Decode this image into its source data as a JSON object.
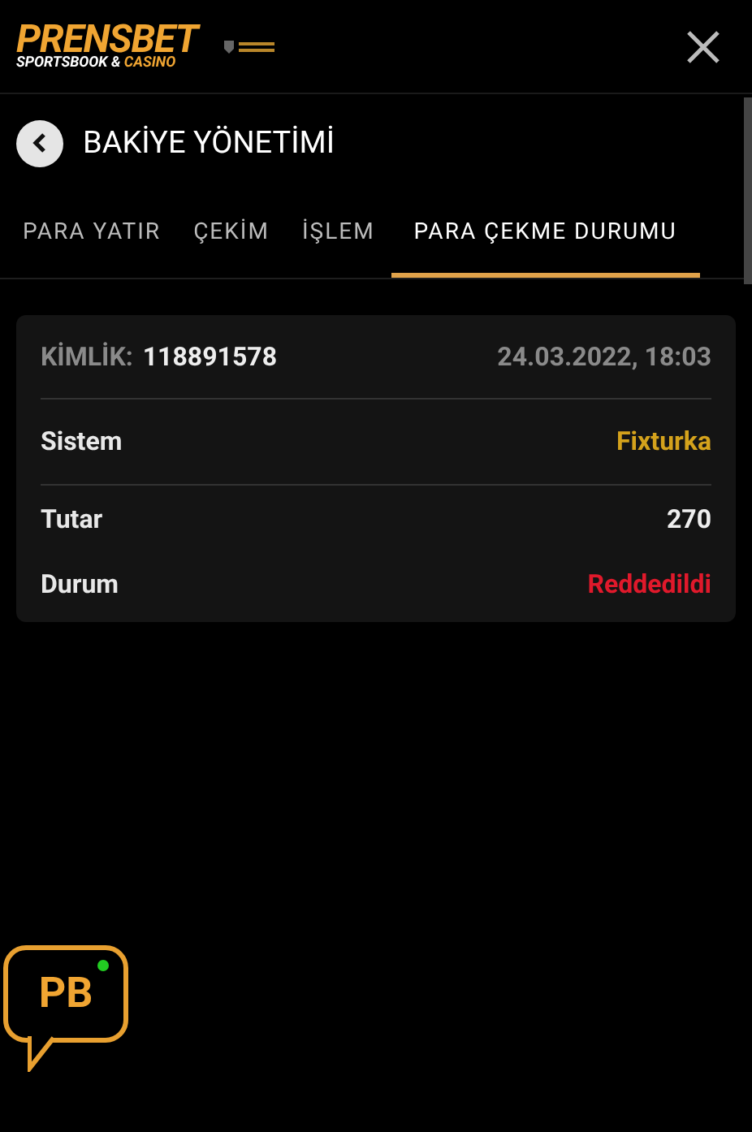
{
  "header": {
    "logo_main": "PRENSBET",
    "logo_sub_1": "SPORTSBOOK &",
    "logo_sub_2": "CASINO"
  },
  "page_title": "BAKİYE YÖNETİMİ",
  "tabs": [
    {
      "label": "PARA YATIR",
      "selected": false
    },
    {
      "label": "ÇEKİM",
      "selected": false
    },
    {
      "label": "İŞLEM",
      "selected": false
    },
    {
      "label": "PARA ÇEKME DURUMU",
      "selected": true
    }
  ],
  "record": {
    "id_label": "KİMLİK:",
    "id_value": "118891578",
    "date": "24.03.2022, 18:03",
    "rows": [
      {
        "label": "Sistem",
        "value": "Fixturka",
        "kind": "system",
        "divider": true
      },
      {
        "label": "Tutar",
        "value": "270",
        "kind": "plain",
        "divider": false
      },
      {
        "label": "Durum",
        "value": "Reddedildi",
        "kind": "status",
        "divider": false
      }
    ]
  },
  "chat": {
    "label": "PB",
    "online": true
  }
}
